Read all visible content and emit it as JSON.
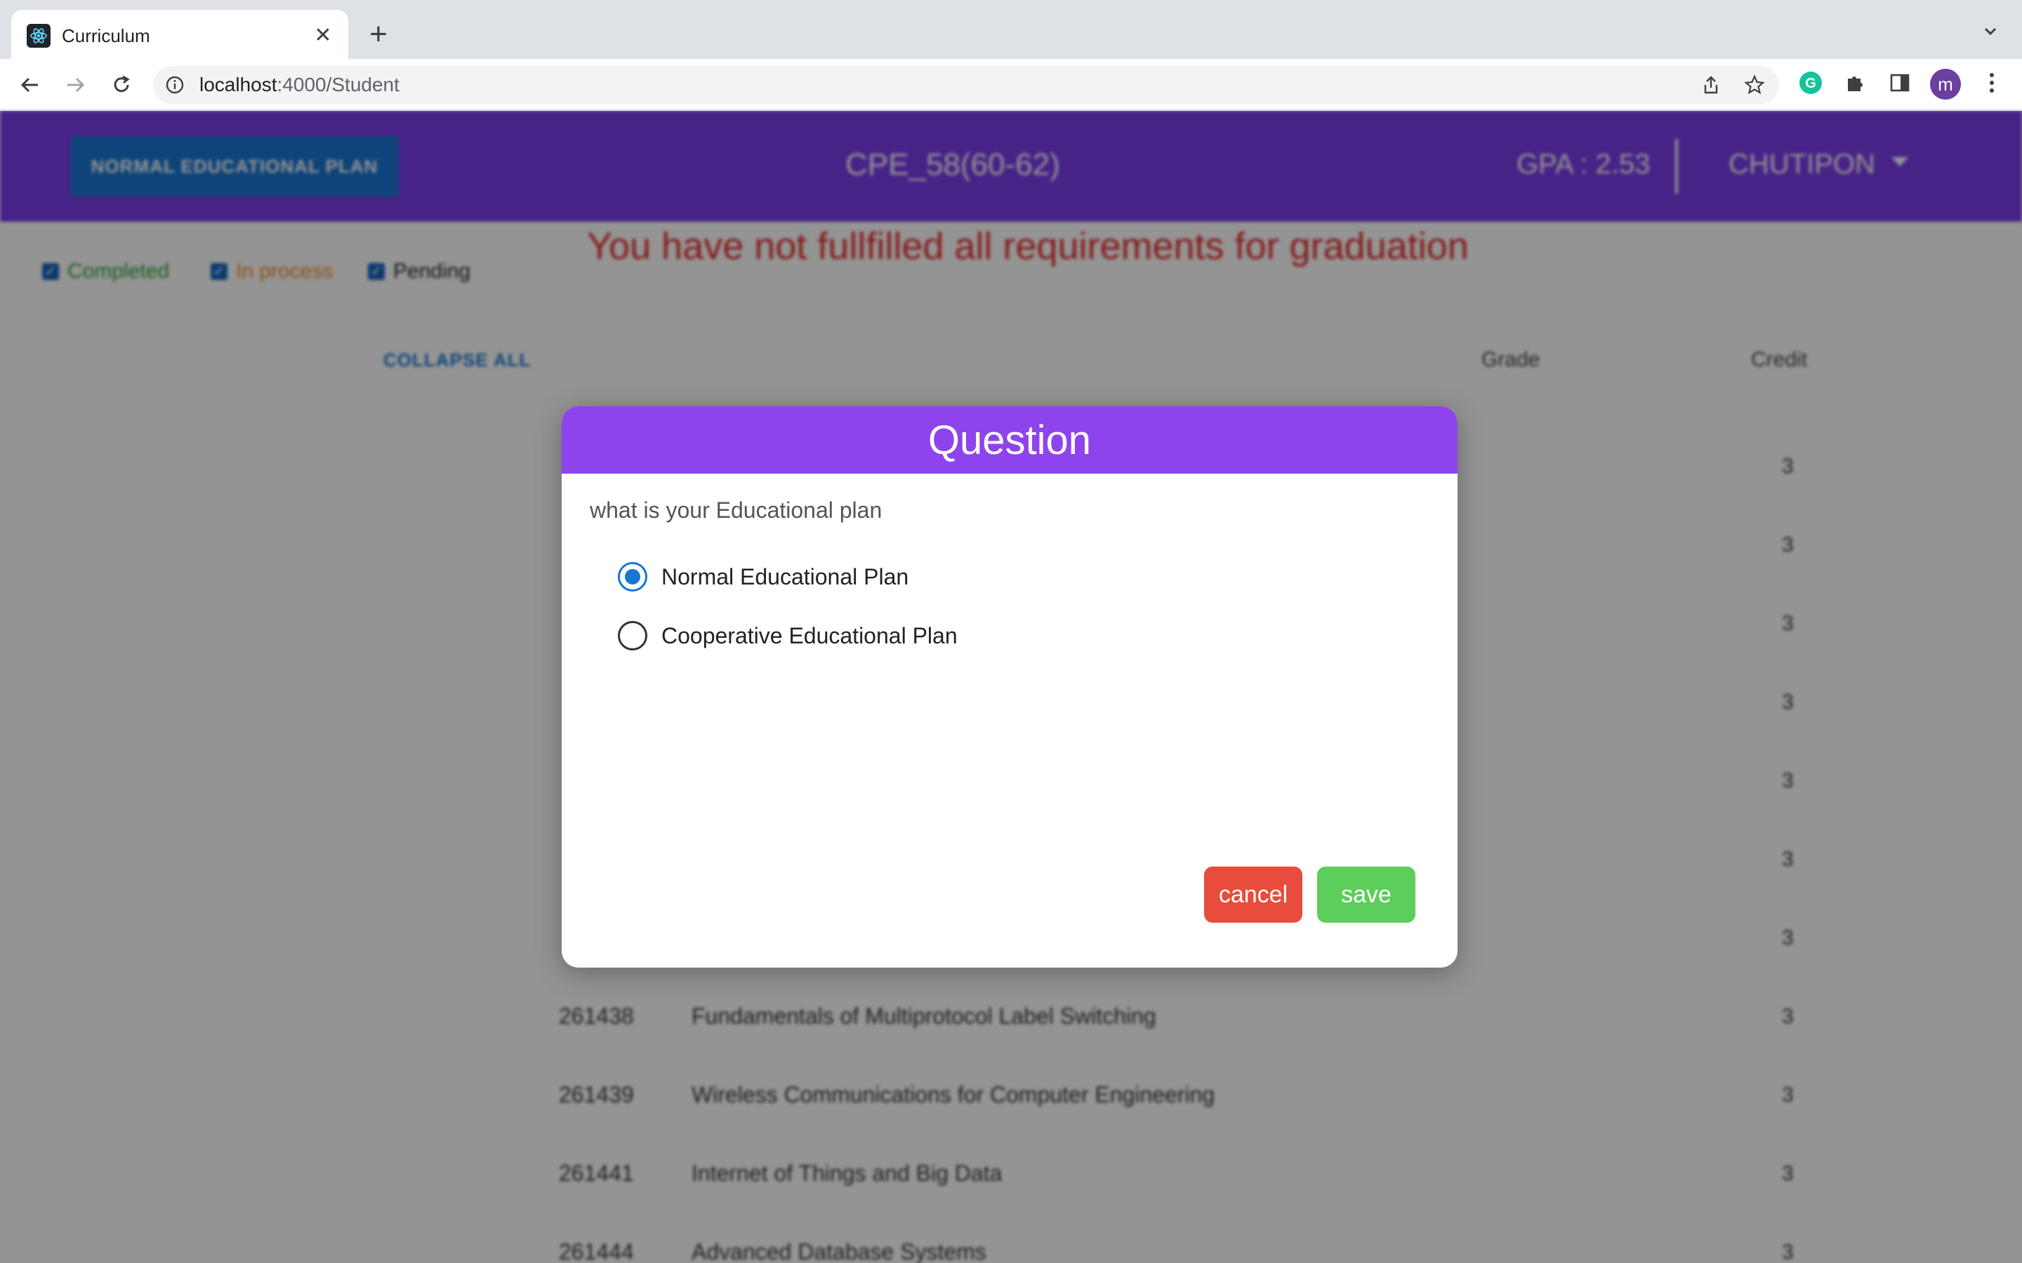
{
  "browser": {
    "tab_title": "Curriculum",
    "url_host": "localhost",
    "url_rest": ":4000/Student",
    "profile_initial": "m"
  },
  "app": {
    "plan_button": "NORMAL EDUCATIONAL PLAN",
    "curriculum_title": "CPE_58(60-62)",
    "gpa": "GPA : 2.53",
    "user_name": "CHUTIPON",
    "graduation_message": "You have not fullfilled all requirements for graduation",
    "legend": [
      {
        "label": "Completed",
        "color": "#2e9e2e"
      },
      {
        "label": "In process",
        "color": "#f08c1a"
      },
      {
        "label": "Pending",
        "color": "#222222"
      }
    ],
    "collapse_all": "COLLAPSE ALL",
    "columns": {
      "grade": "Grade",
      "credit": "Credit"
    },
    "hidden_credits": [
      "3",
      "3",
      "3",
      "3",
      "3",
      "3",
      "3"
    ],
    "courses": [
      {
        "code": "261438",
        "name": "Fundamentals of Multiprotocol Label Switching",
        "credit": "3"
      },
      {
        "code": "261439",
        "name": "Wireless Communications for Computer Engineering",
        "credit": "3"
      },
      {
        "code": "261441",
        "name": "Internet of Things and Big Data",
        "credit": "3"
      },
      {
        "code": "261444",
        "name": "Advanced Database Systems",
        "credit": "3"
      }
    ]
  },
  "dialog": {
    "title": "Question",
    "prompt": "what is your Educational plan",
    "options": [
      {
        "label": "Normal Educational Plan",
        "selected": true
      },
      {
        "label": "Cooperative Educational Plan",
        "selected": false
      }
    ],
    "cancel_label": "cancel",
    "save_label": "save"
  },
  "colors": {
    "header_purple": "#7a3ce8",
    "dialog_header": "#8e44ec",
    "cancel_red": "#e74c3c",
    "save_green": "#5cce5c",
    "radio_blue": "#1976d2"
  }
}
